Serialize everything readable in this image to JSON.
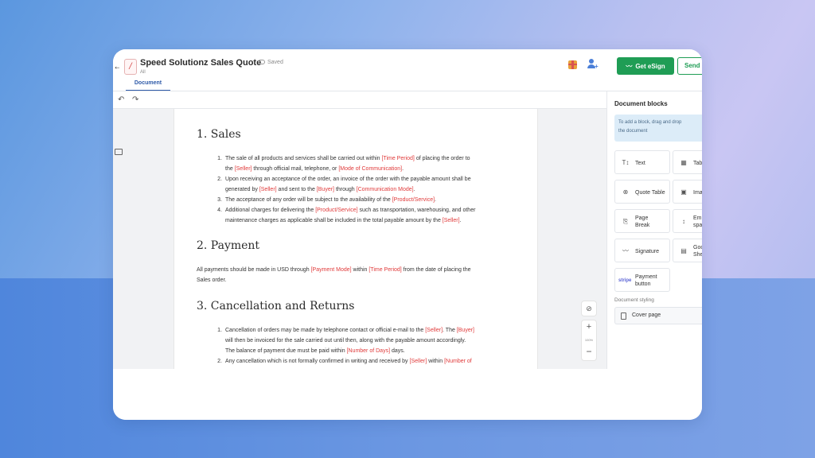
{
  "header": {
    "title": "Speed Solutionz Sales Quote",
    "subtitle": "All",
    "saved_label": "Saved",
    "esign_label": "Get eSign",
    "send_label": "Send",
    "tab_document": "Document"
  },
  "document": {
    "top_partial_line": "",
    "sections": [
      {
        "heading": "1. Sales"
      },
      {
        "heading": "2. Payment"
      },
      {
        "heading": "3. Cancellation and Returns"
      }
    ],
    "sales_items": {
      "i1_a": "The sale of all products and services shall be carried out within ",
      "i1_ph1": "[Time Period]",
      "i1_b": " of placing the order to",
      "i1_c": "the ",
      "i1_ph2": "[Seller]",
      "i1_d": " through official mail, telephone, or ",
      "i1_ph3": "[Mode of Communication]",
      "i1_e": ".",
      "i2_a": "Upon receiving an acceptance of the order, an invoice of the order with the payable amount shall be",
      "i2_b": "generated by ",
      "i2_ph1": "[Seller]",
      "i2_c": " and sent to the ",
      "i2_ph2": "[Buyer]",
      "i2_d": " through ",
      "i2_ph3": "[Communication Mode]",
      "i2_e": ".",
      "i3_a": "The acceptance of any order will be subject to the availability of the ",
      "i3_ph1": "[Product/Service]",
      "i3_b": ".",
      "i4_a": "Additional charges for delivering the ",
      "i4_ph1": "[Product/Service]",
      "i4_b": " such as transportation, warehousing, and other",
      "i4_c": "maintenance charges as applicable shall be included in the total payable amount by the ",
      "i4_ph2": "[Seller]",
      "i4_d": "."
    },
    "payment": {
      "a": "All payments should be made in USD through ",
      "ph1": "[Payment Mode]",
      "b": " within ",
      "ph2": "[Time Period]",
      "c": " from the date of placing the",
      "d": "Sales order."
    },
    "cancel_items": {
      "i1_a": "Cancellation of orders may be made by telephone contact or official e-mail to the ",
      "i1_ph1": "[Seller]",
      "i1_b": ". The ",
      "i1_ph2": "[Buyer]",
      "i1_c": "will then be invoiced for the sale carried out until then, along with the payable amount accordingly.",
      "i1_d": "The balance of payment due must be paid within ",
      "i1_ph3": "[Number of Days]",
      "i1_e": " days.",
      "i2_a": "Any cancellation which is not formally confirmed in writing and received by ",
      "i2_ph1": "[Seller]",
      "i2_b": " within ",
      "i2_ph2": "[Number of"
    },
    "nums": [
      "1.",
      "2.",
      "3.",
      "4."
    ]
  },
  "zoom": {
    "plus": "+",
    "level": "100%",
    "minus": "−"
  },
  "panel": {
    "title": "Document blocks",
    "hint_line1": "To add a block, drag and drop",
    "hint_line2": "the document",
    "blocks": [
      {
        "label": "Text",
        "icon": "text-icon"
      },
      {
        "label": "Tab",
        "icon": "table-icon"
      },
      {
        "label": "Quote Table",
        "icon": "quote-table-icon"
      },
      {
        "label": "Ima",
        "icon": "image-icon"
      },
      {
        "label": "Page Break",
        "icon": "page-break-icon"
      },
      {
        "label": "Em spa",
        "icon": "empty-space-icon"
      },
      {
        "label": "Signature",
        "icon": "signature-icon"
      },
      {
        "label": "Goo She",
        "icon": "google-sheets-icon"
      },
      {
        "label": "Payment button",
        "icon": "stripe-icon"
      }
    ],
    "stripe_text": "stripe",
    "styling_label": "Document styling",
    "cover_page_label": "Cover page"
  }
}
